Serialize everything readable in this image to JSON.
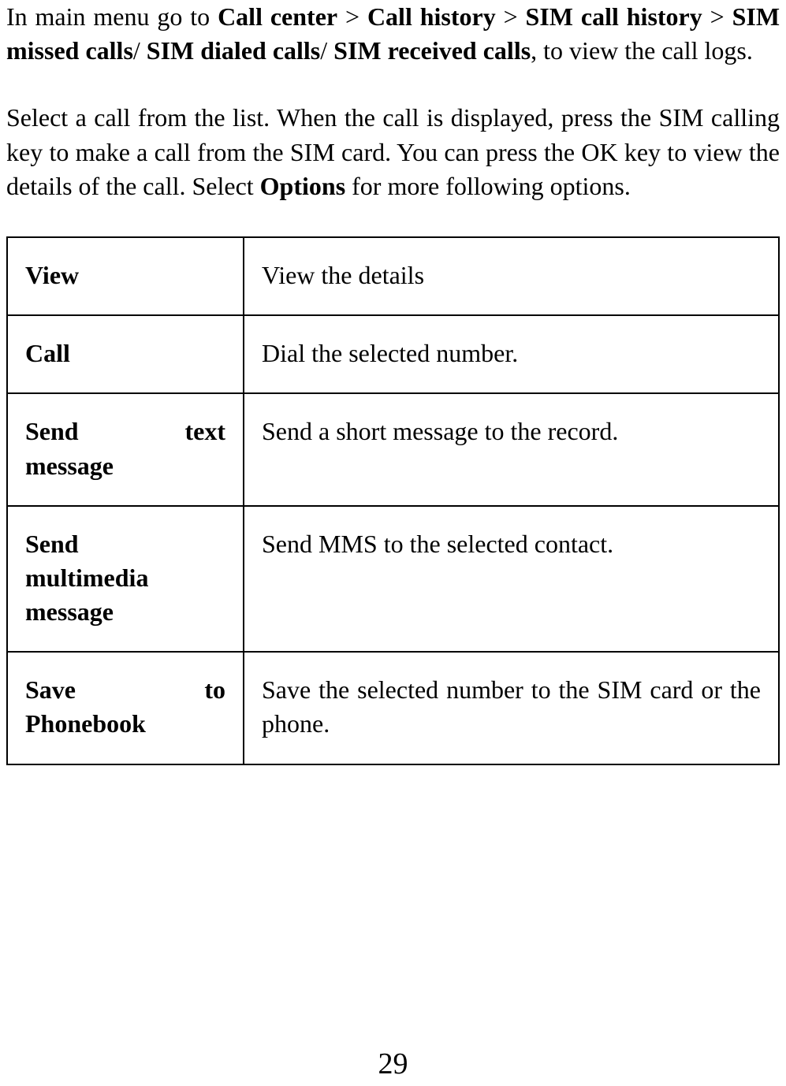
{
  "paragraph1": {
    "pre": "In main menu go to ",
    "b1": "Call center",
    "sep1": " > ",
    "b2": "Call history",
    "sep2": " > ",
    "b3": "SIM call history",
    "sep3": " > ",
    "b4": "SIM missed calls",
    "sep4": "/ ",
    "b5": "SIM dialed calls",
    "sep5": "/ ",
    "b6": "SIM received calls",
    "post": ", to view the call logs."
  },
  "paragraph2": {
    "pre": "Select a call from the list. When the call is displayed, press the SIM calling key to make a call from the SIM card. You can press the OK key to view the details of the call. Select ",
    "b1": "Options",
    "post": " for more following options."
  },
  "table": {
    "rows": [
      {
        "name": "View",
        "desc": "View the details"
      },
      {
        "name": "Call",
        "desc": "Dial the selected number."
      },
      {
        "name_line1": "Send",
        "name_line2": "text",
        "name_line3": "message",
        "desc": "Send a short message to the record."
      },
      {
        "name_line1": "Send",
        "name_line2": "multimedia",
        "name_line3": "message",
        "desc": "Send MMS to the selected contact."
      },
      {
        "name_line1": "Save",
        "name_line2": "to",
        "name_line3": "Phonebook",
        "desc": "Save the selected number to the SIM card or the phone."
      }
    ]
  },
  "pageNumber": "29"
}
